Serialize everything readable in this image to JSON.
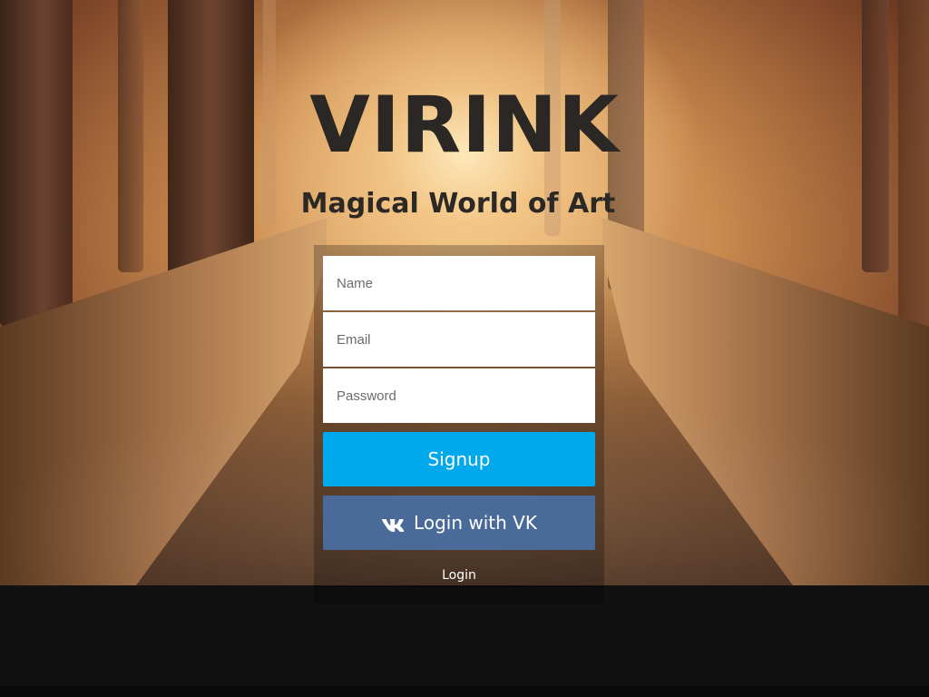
{
  "brand": {
    "title": "VIRINK",
    "tagline": "Magical World of Art"
  },
  "form": {
    "name_placeholder": "Name",
    "email_placeholder": "Email",
    "password_placeholder": "Password",
    "signup_label": "Signup",
    "vk_label": "Login with VK",
    "vk_icon": "vk-logo-icon",
    "login_label": "Login"
  },
  "colors": {
    "signup_button": "#00a8ec",
    "vk_button": "#4a6b9a",
    "footer_band": "#111111"
  }
}
